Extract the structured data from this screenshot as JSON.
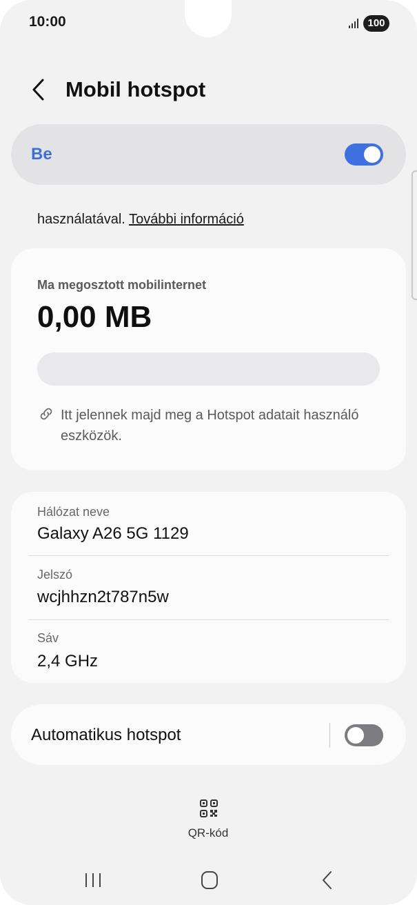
{
  "status_bar": {
    "time": "10:00",
    "battery": "100",
    "signal_icon": "signal-bars-icon"
  },
  "header": {
    "title": "Mobil hotspot",
    "back_icon": "back-chevron-icon"
  },
  "master_switch": {
    "label": "Be",
    "state": "on",
    "accent_color": "#3e70df"
  },
  "info": {
    "text": "használatával.",
    "link": "További információ"
  },
  "usage": {
    "label": "Ma megosztott mobilinternet",
    "value": "0,00 MB",
    "progress_fraction": 0,
    "devices_note": "Itt jelennek majd meg a Hotspot adatait használó eszközök.",
    "note_icon": "link-icon"
  },
  "network": {
    "rows": [
      {
        "label": "Hálózat neve",
        "value": "Galaxy A26 5G 1129"
      },
      {
        "label": "Jelszó",
        "value": "wcjhhzn2t787n5w"
      },
      {
        "label": "Sáv",
        "value": "2,4 GHz"
      }
    ]
  },
  "auto_hotspot": {
    "label": "Automatikus hotspot",
    "state": "off"
  },
  "qr": {
    "label": "QR-kód",
    "icon": "qr-code-icon"
  },
  "nav": {
    "recents_icon": "recents-icon",
    "home_icon": "home-icon",
    "back_icon": "back-icon"
  }
}
